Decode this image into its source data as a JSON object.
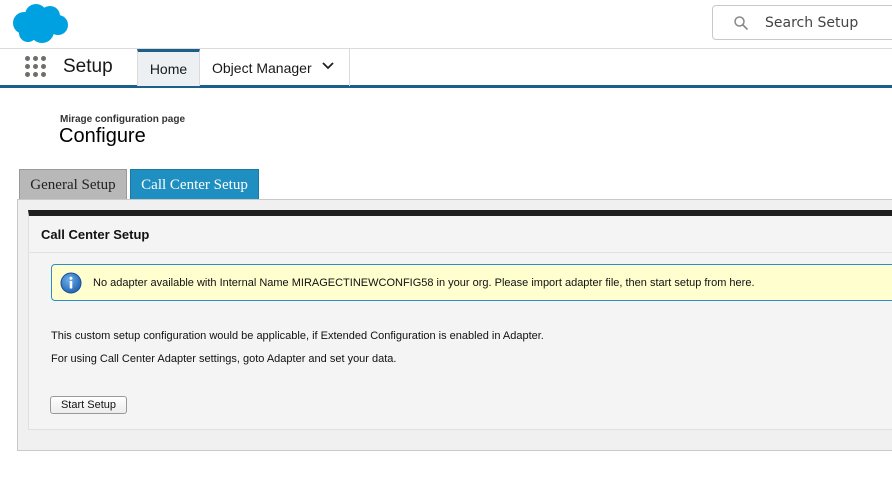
{
  "header": {
    "logo": "salesforce-cloud-logo",
    "search_placeholder": "Search Setup",
    "search_icon": "search-icon"
  },
  "context_bar": {
    "app_launcher_icon": "app-launcher-icon",
    "app_name": "Setup",
    "tabs": [
      {
        "label": "Home",
        "active": true
      },
      {
        "label": "Object Manager",
        "dropdown": true
      }
    ]
  },
  "page": {
    "subtitle": "Mirage configuration page",
    "title": "Configure"
  },
  "config_tabs": [
    {
      "label": "General Setup",
      "active": false
    },
    {
      "label": "Call Center Setup",
      "active": true
    }
  ],
  "panel": {
    "title": "Call Center Setup",
    "info_message": "No adapter available with Internal Name MIRAGECTINEWCONFIG58 in your org. Please import adapter file, then start setup from here.",
    "line1": "This custom setup configuration would be applicable, if Extended Configuration is enabled in Adapter.",
    "line2": "For using Call Center Adapter settings, goto Adapter and set your data.",
    "start_button": "Start Setup"
  },
  "colors": {
    "brand_blue": "#00a1e0",
    "nav_accent": "#1b5f8a",
    "active_tab": "#1f8fc1",
    "info_bg": "#fefecf"
  }
}
